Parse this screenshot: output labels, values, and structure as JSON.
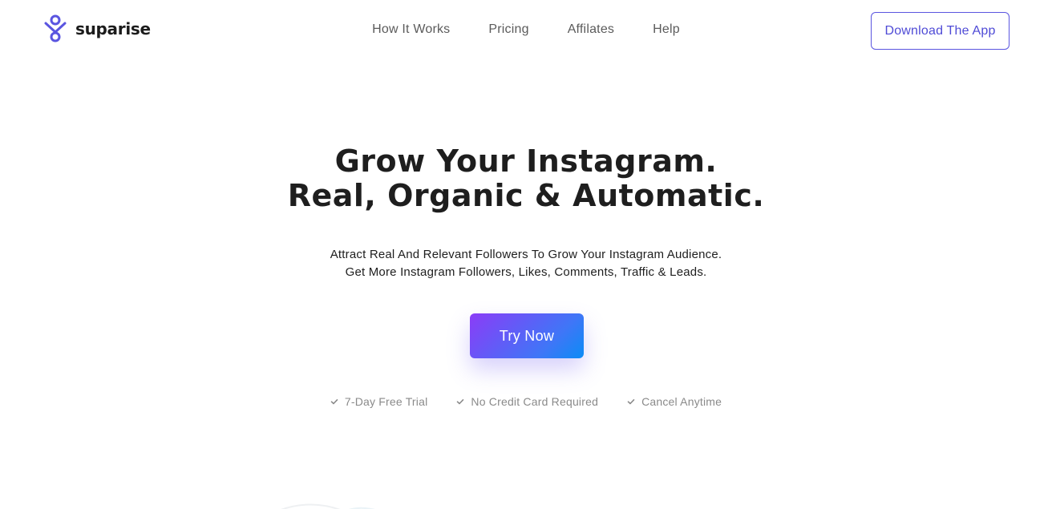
{
  "brand": {
    "name": "suparise",
    "logo_icon": "person-node-icon",
    "accent_color": "#5a55e0"
  },
  "nav": {
    "items": [
      {
        "label": "How It Works"
      },
      {
        "label": "Pricing"
      },
      {
        "label": "Affilates"
      },
      {
        "label": "Help"
      }
    ],
    "download_label": "Download The App"
  },
  "hero": {
    "title_line1": "Grow Your Instagram.",
    "title_line2": "Real, Organic & Automatic.",
    "subtitle_line1": "Attract Real And Relevant Followers To Grow Your Instagram Audience.",
    "subtitle_line2": "Get More Instagram Followers, Likes, Comments, Traffic & Leads.",
    "cta_label": "Try Now",
    "cta_gradient": [
      "#8b3cf7",
      "#0b8cf5"
    ]
  },
  "features": [
    {
      "icon": "check-icon",
      "label": "7-Day Free Trial"
    },
    {
      "icon": "check-icon",
      "label": "No Credit Card Required"
    },
    {
      "icon": "check-icon",
      "label": "Cancel Anytime"
    }
  ]
}
